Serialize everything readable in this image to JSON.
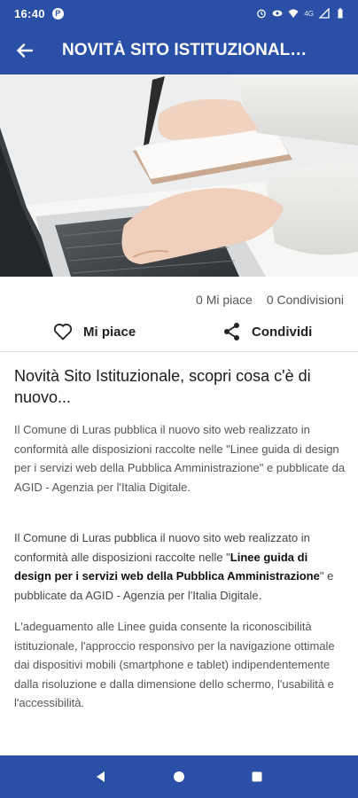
{
  "status_bar": {
    "time": "16:40",
    "app_icon_letter": "P",
    "network": "4G"
  },
  "app_bar": {
    "title": "NOVITÀ SITO ISTITUZIONALE, ..."
  },
  "hero": {
    "icon": "typing-on-laptop-photo"
  },
  "stats": {
    "likes": "0 Mi piace",
    "shares": "0 Condivisioni"
  },
  "actions": {
    "like_label": "Mi piace",
    "share_label": "Condividi"
  },
  "article": {
    "title": "Novità Sito Istituzionale, scopri cosa c'è di nuovo...",
    "summary": "Il Comune di Luras pubblica il nuovo sito web realizzato in conformità alle disposizioni raccolte nelle \"Linee guida di design per i servizi web della Pubblica Amministrazione\" e pubblicate da AGID - Agenzia per l'Italia Digitale.",
    "body_before": "Il Comune di Luras pubblica il nuovo sito web realizzato in conformità alle disposizioni raccolte nelle \"",
    "body_bold": "Linee guida di design per i servizi web della Pubblica Amministrazione",
    "body_after": "\" e pubblicate da AGID - Agenzia per l'Italia Digitale.",
    "body_2": "L'adeguamento alle Linee guida consente la riconoscibilità istituzionale, l'approccio responsivo per la navigazione ottimale dai dispositivi mobili (smartphone e tablet) indipendentemente dalla risoluzione e dalla dimensione dello schermo, l'usabilità e l'accessibilità."
  },
  "colors": {
    "primary": "#2a4fa6"
  }
}
